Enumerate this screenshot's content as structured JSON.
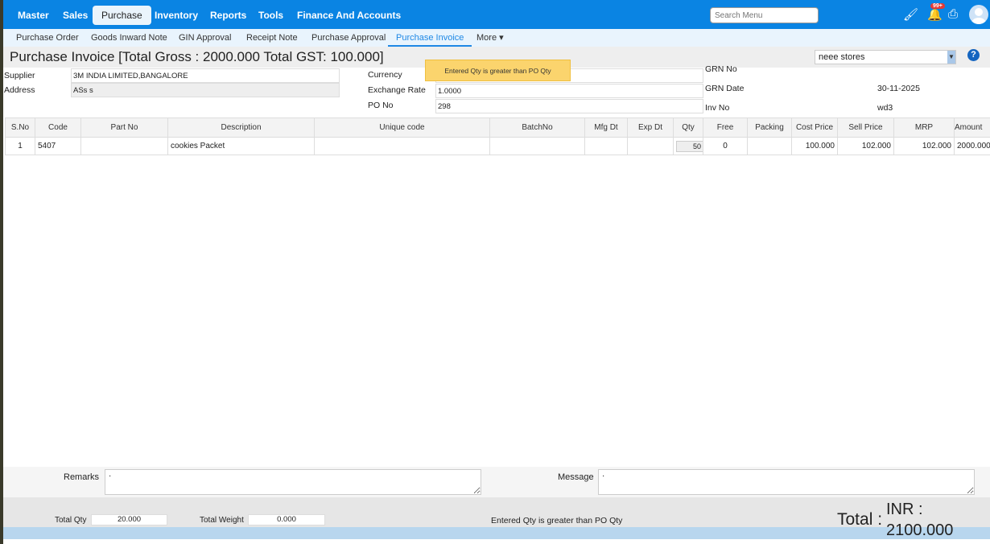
{
  "nav": [
    "Master",
    "Sales",
    "Purchase",
    "Inventory",
    "Reports",
    "Tools",
    "Finance And Accounts"
  ],
  "search_placeholder": "Search Menu",
  "notif_badge": "99+",
  "subnav": [
    "Purchase Order",
    "Goods Inward Note",
    "GIN Approval",
    "Receipt Note",
    "Purchase Approval",
    "Purchase Invoice",
    "More ▾"
  ],
  "title": "Purchase Invoice [Total Gross : 2000.000 Total GST: 100.000]",
  "store": "neee stores",
  "help": "?",
  "form": {
    "supplier_label": "Supplier",
    "supplier": "3M INDIA LIMITED,BANGALORE",
    "address_label": "Address",
    "address": "ASs s",
    "currency_label": "Currency",
    "exchange_label": "Exchange Rate",
    "exchange": "1.0000",
    "po_label": "PO No",
    "po": "298",
    "grn_no_label": "GRN No",
    "grn_date_label": "GRN Date",
    "grn_date": "30-11-2025",
    "inv_label": "Inv No",
    "inv": "wd3"
  },
  "toast": "Entered Qty is greater than PO Qty",
  "table": {
    "headers": [
      "S.No",
      "Code",
      "Part No",
      "Description",
      "Unique code",
      "BatchNo",
      "Mfg Dt",
      "Exp Dt",
      "Qty",
      "Free",
      "Packing",
      "Cost Price",
      "Sell Price",
      "MRP",
      "Amount"
    ],
    "rows": [
      {
        "sno": "1",
        "code": "5407",
        "part": "",
        "desc": "cookies Packet",
        "unique": "",
        "batch": "",
        "mfg": "",
        "exp": "",
        "qty": "50",
        "free": "0",
        "packing": "",
        "cost": "100.000",
        "sell": "102.000",
        "mrp": "102.000",
        "amount": "2000.000"
      }
    ]
  },
  "remarks_label": "Remarks",
  "remarks": "·",
  "message_label": "Message",
  "message": "·",
  "footer": {
    "total_qty_label": "Total Qty",
    "total_qty": "20.000",
    "total_weight_label": "Total Weight",
    "total_weight": "0.000",
    "status": "Entered Qty is greater than PO Qty",
    "total_label": "Total :",
    "total_currency": "INR :",
    "total_value": "2100.000"
  }
}
